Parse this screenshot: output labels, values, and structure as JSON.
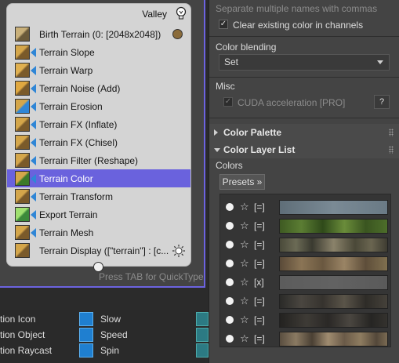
{
  "canvas": {
    "hint": "Press TAB for QuickType"
  },
  "node": {
    "title": "Valley",
    "items": [
      {
        "label": "Birth Terrain (0: [2048x2048])",
        "icon": "birth-terrain",
        "colors": [
          "#6b5a3a",
          "#c9b07a"
        ],
        "extra": "dot"
      },
      {
        "label": "Terrain Slope",
        "icon": "terrain-slope",
        "colors": [
          "#7a5a2a",
          "#d4a64a"
        ],
        "arrow": true
      },
      {
        "label": "Terrain Warp",
        "icon": "terrain-warp",
        "colors": [
          "#7a5a2a",
          "#e0b050"
        ],
        "arrow": true
      },
      {
        "label": "Terrain Noise (Add)",
        "icon": "terrain-noise",
        "colors": [
          "#7a5a2a",
          "#e0a840"
        ],
        "arrow": true
      },
      {
        "label": "Terrain Erosion",
        "icon": "terrain-erosion",
        "colors": [
          "#2f86d6",
          "#d4a64a"
        ],
        "arrow": true
      },
      {
        "label": "Terrain FX (Inflate)",
        "icon": "terrain-fx-inflate",
        "colors": [
          "#7a5a2a",
          "#d4a64a"
        ],
        "arrow": true
      },
      {
        "label": "Terrain FX (Chisel)",
        "icon": "terrain-fx-chisel",
        "colors": [
          "#7a5a2a",
          "#d4a64a"
        ],
        "arrow": true
      },
      {
        "label": "Terrain Filter (Reshape)",
        "icon": "terrain-filter",
        "colors": [
          "#7a5a2a",
          "#d4a64a"
        ],
        "arrow": true
      },
      {
        "label": "Terrain Color",
        "icon": "terrain-color",
        "colors": [
          "#3c7a2a",
          "#d4a64a"
        ],
        "arrow": true,
        "selected": true
      },
      {
        "label": "Terrain Transform",
        "icon": "terrain-transform",
        "colors": [
          "#7a5a2a",
          "#d4a64a"
        ],
        "arrow": true
      },
      {
        "label": "Export Terrain",
        "icon": "export-terrain",
        "colors": [
          "#3c8a3a",
          "#9fe070"
        ],
        "arrow": true
      },
      {
        "label": "Terrain Mesh",
        "icon": "terrain-mesh",
        "colors": [
          "#7a5a2a",
          "#d4a64a"
        ],
        "arrow": true
      },
      {
        "label": "Terrain Display ([\"terrain\"] : [c...",
        "icon": "terrain-display",
        "colors": [
          "#7a5a2a",
          "#d4a64a"
        ],
        "extra": "sun"
      }
    ]
  },
  "bottom": {
    "left_items": [
      "tion Icon",
      "tion Object",
      "tion Raycast"
    ],
    "right_items": [
      "Slow",
      "Speed",
      "Spin"
    ]
  },
  "panel": {
    "separate_hint": "Separate multiple names with commas",
    "clear_label": "Clear existing color in channels",
    "clear_checked": true,
    "blending_label": "Color blending",
    "blending_value": "Set",
    "misc_label": "Misc",
    "cuda_label": "CUDA acceleration [PRO]",
    "help_label": "?",
    "palette_header": "Color Palette",
    "layer_header": "Color Layer List",
    "colors_label": "Colors",
    "presets_label": "Presets »",
    "layers": [
      {
        "star": "☆",
        "mode": "[=]",
        "gradient": "linear-gradient(90deg,#5f6e78,#7a8a95 50%,#6a7a85)"
      },
      {
        "star": "☆",
        "mode": "[=]",
        "gradient": "linear-gradient(90deg,#3e5a22,#5b7d33 20%,#2f4a1a 40%,#6a8c3a 60%,#3a5520 80%,#4d6e2a)"
      },
      {
        "star": "☆",
        "mode": "[=]",
        "gradient": "linear-gradient(90deg,#4a4a3a,#6b6a55 15%,#3a3a30 30%,#8a826a 50%,#4a4838 70%,#6a6550 85%,#3e3c32)"
      },
      {
        "star": "☆",
        "mode": "[=]",
        "gradient": "linear-gradient(90deg,#5a4a38,#8a7455 20%,#6a5840 40%,#9a8465 60%,#5e4e3a 80%,#80704f)"
      },
      {
        "star": "☆",
        "mode": "[x]",
        "gradient": "linear-gradient(90deg,#5c5c5c,#626262 50%,#5a5a5a)"
      },
      {
        "star": "☆",
        "mode": "[=]",
        "gradient": "linear-gradient(90deg,#2a2a28,#4a4640 20%,#36332e 40%,#5a5449 60%,#2e2c28 80%,#45413a)"
      },
      {
        "star": "☆",
        "mode": "[=]",
        "gradient": "linear-gradient(90deg,#232220,#3e3b36 25%,#2a2826 45%,#4a4640 65%,#262523 85%,#34322e)"
      },
      {
        "star": "☆",
        "mode": "[=]",
        "gradient": "linear-gradient(90deg,#5a4e40,#8a7a62 15%,#4a4034 30%,#a08c70 45%,#6a5a48 60%,#8e7c60 75%,#54483a 90%,#7a6a52)"
      }
    ]
  }
}
